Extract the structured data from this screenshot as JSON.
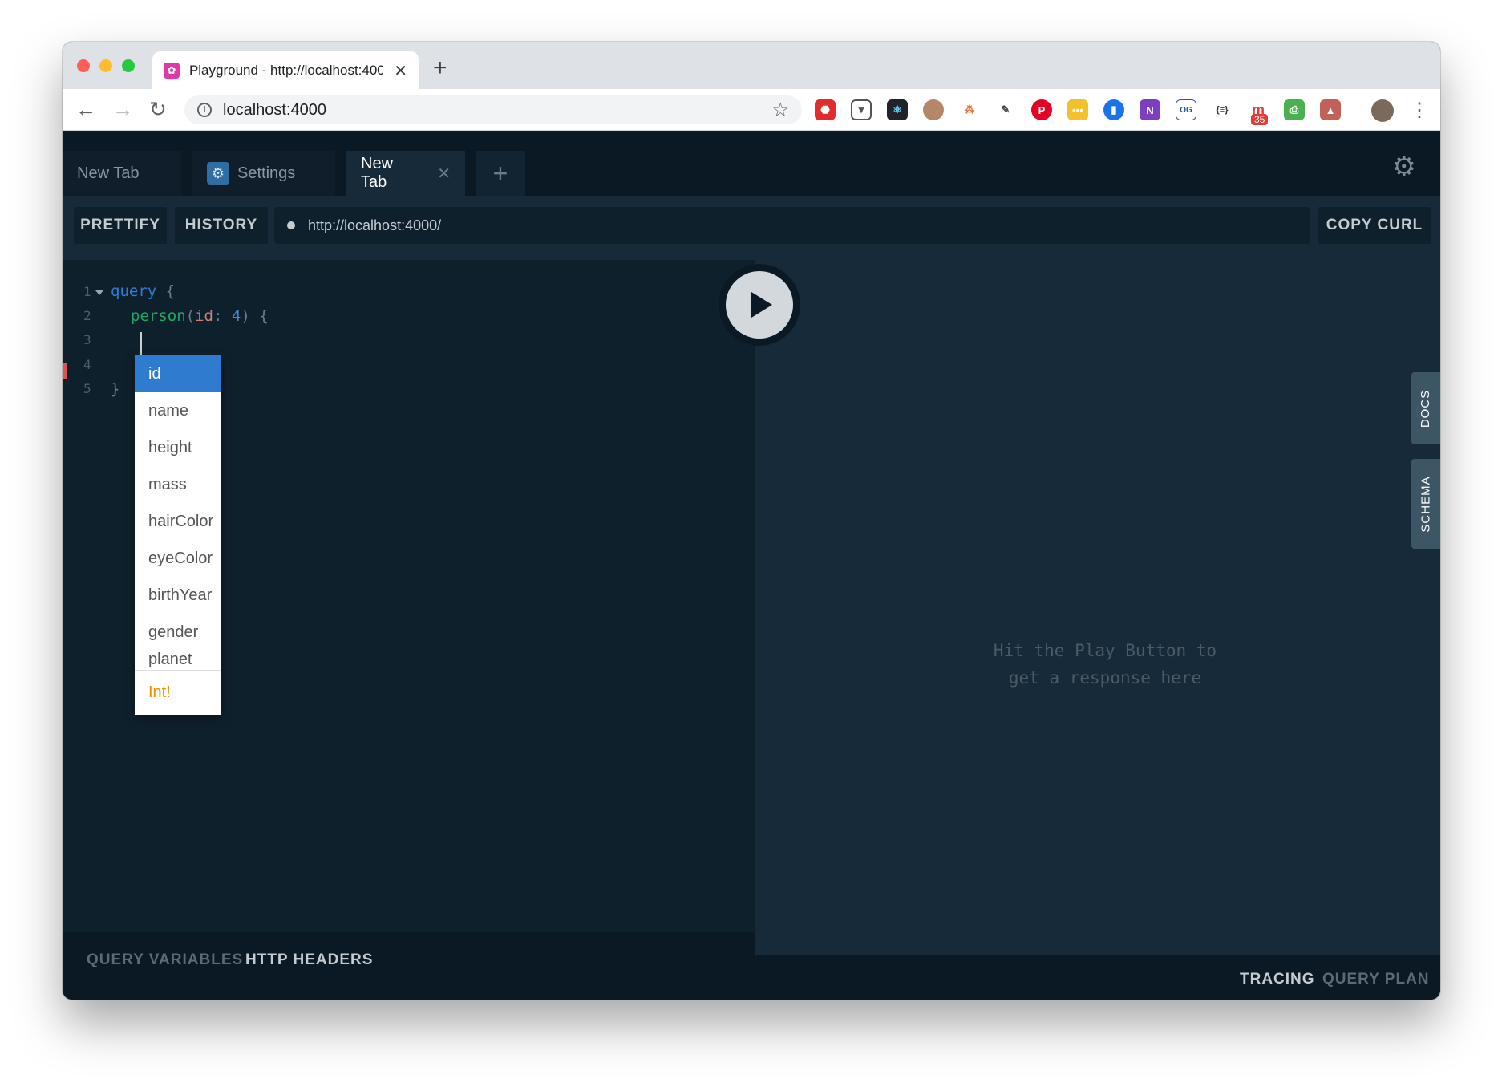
{
  "browser": {
    "tab_title": "Playground - http://localhost:4000/",
    "url": "localhost:4000"
  },
  "playground": {
    "tabs": [
      {
        "label": "New Tab"
      },
      {
        "label": "Settings"
      },
      {
        "label": "New Tab"
      }
    ],
    "toolbar": {
      "prettify": "PRETTIFY",
      "history": "HISTORY",
      "endpoint": "http://localhost:4000/",
      "copy_curl": "COPY CURL"
    },
    "editor": {
      "line_numbers": [
        "1",
        "2",
        "3",
        "4",
        "5"
      ],
      "lines": {
        "l1_keyword": "query",
        "l1_brace": " {",
        "l2_field": "person",
        "l2_open": "(",
        "l2_arg": "id",
        "l2_colon": ": ",
        "l2_value": "4",
        "l2_close": ") {",
        "l5": "}"
      }
    },
    "autocomplete": {
      "items": [
        "id",
        "name",
        "height",
        "mass",
        "hairColor",
        "eyeColor",
        "birthYear",
        "gender",
        "planet"
      ],
      "selected": "id",
      "type": "Int!"
    },
    "result": {
      "hint_line1": "Hit the Play Button to",
      "hint_line2": "get a response here"
    },
    "side_tabs": {
      "docs": "DOCS",
      "schema": "SCHEMA"
    },
    "bottom": {
      "query_variables": "QUERY VARIABLES",
      "http_headers": "HTTP HEADERS",
      "tracing": "TRACING",
      "query_plan": "QUERY PLAN"
    }
  },
  "colors": {
    "background": "#0f202d",
    "accent": "#2e7bd0",
    "type_hint": "#f28b00"
  }
}
